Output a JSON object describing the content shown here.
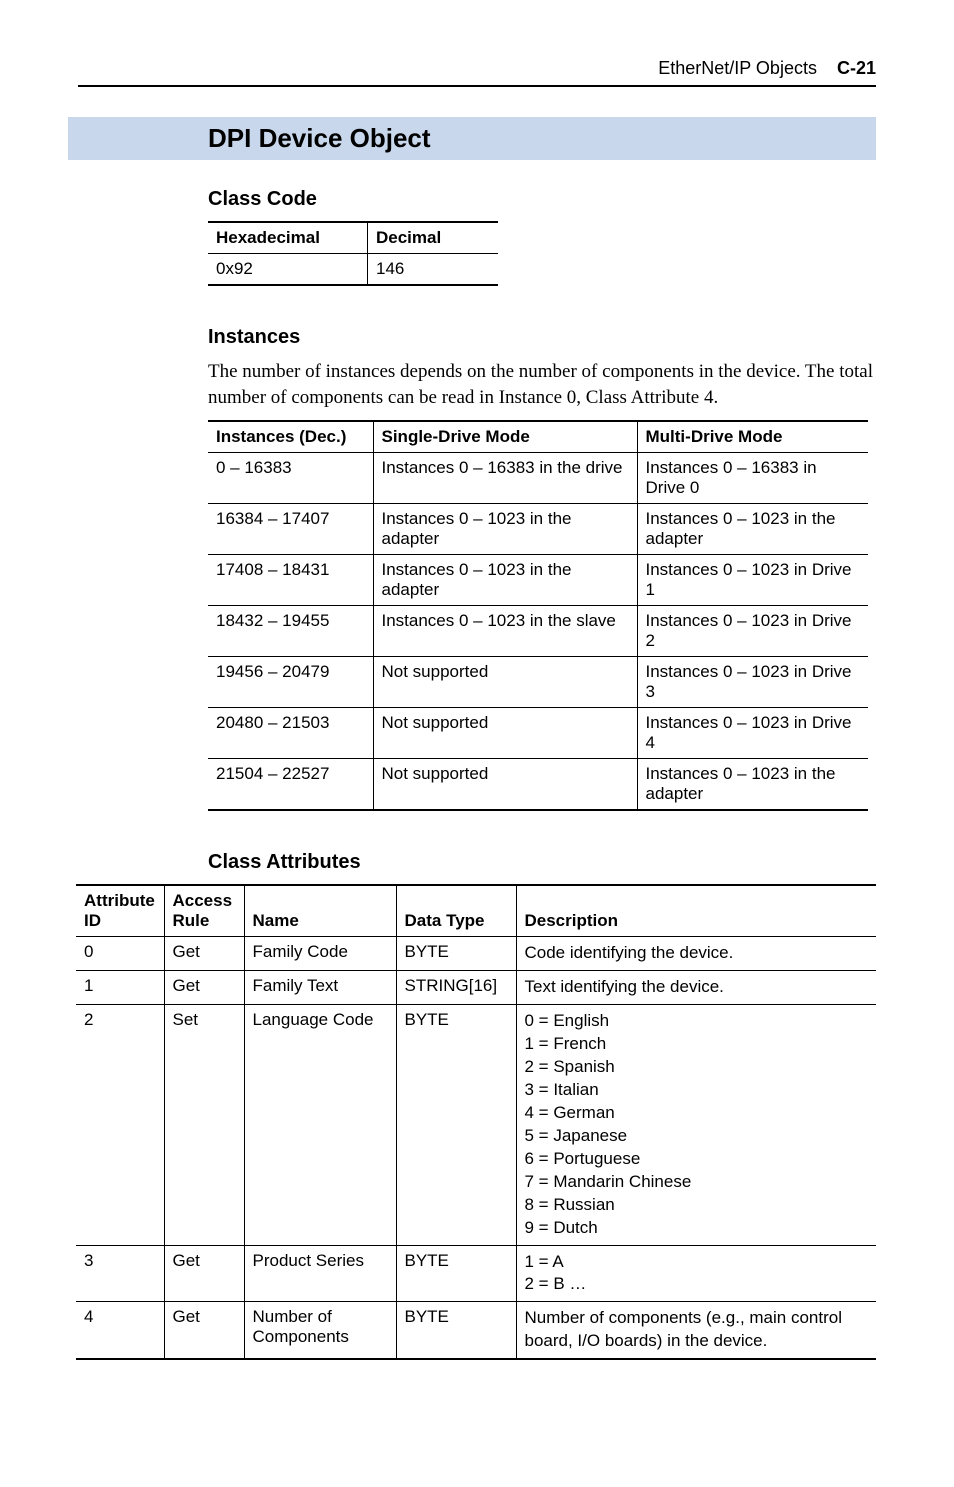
{
  "header": {
    "title": "EtherNet/IP Objects",
    "page_code": "C-21"
  },
  "section_title": "DPI Device Object",
  "class_code": {
    "heading": "Class Code",
    "headers": [
      "Hexadecimal",
      "Decimal"
    ],
    "row": [
      "0x92",
      "146"
    ]
  },
  "instances": {
    "heading": "Instances",
    "paragraph": "The number of instances depends on the number of components in the device. The total number of components can be read in Instance 0, Class Attribute 4.",
    "headers": [
      "Instances (Dec.)",
      "Single-Drive Mode",
      "Multi-Drive Mode"
    ],
    "rows": [
      [
        "0 – 16383",
        "Instances 0 – 16383 in the drive",
        "Instances 0 – 16383 in Drive 0"
      ],
      [
        "16384 – 17407",
        "Instances 0 – 1023 in the adapter",
        "Instances 0 – 1023 in the adapter"
      ],
      [
        "17408 – 18431",
        "Instances 0 – 1023 in the adapter",
        "Instances 0 – 1023 in Drive 1"
      ],
      [
        "18432 – 19455",
        "Instances 0 – 1023 in the slave",
        "Instances 0 – 1023 in Drive 2"
      ],
      [
        "19456 – 20479",
        "Not supported",
        "Instances 0 – 1023 in Drive 3"
      ],
      [
        "20480 – 21503",
        "Not supported",
        "Instances 0 – 1023 in Drive 4"
      ],
      [
        "21504 – 22527",
        "Not supported",
        "Instances 0 – 1023 in the adapter"
      ]
    ]
  },
  "class_attrs": {
    "heading": "Class Attributes",
    "headers": [
      "Attribute\nID",
      "Access\nRule",
      "Name",
      "Data Type",
      "Description"
    ],
    "rows": [
      {
        "id": "0",
        "rule": "Get",
        "name": "Family Code",
        "type": "BYTE",
        "desc": "Code identifying the device."
      },
      {
        "id": "1",
        "rule": "Get",
        "name": "Family Text",
        "type": "STRING[16]",
        "desc": "Text identifying the device."
      },
      {
        "id": "2",
        "rule": "Set",
        "name": "Language Code",
        "type": "BYTE",
        "desc": "0 = English\n1 = French\n2 = Spanish\n3 = Italian\n4 = German\n5 = Japanese\n6 = Portuguese\n7 = Mandarin Chinese\n8 = Russian\n9 = Dutch"
      },
      {
        "id": "3",
        "rule": "Get",
        "name": "Product Series",
        "type": "BYTE",
        "desc": "1 = A\n2 = B …"
      },
      {
        "id": "4",
        "rule": "Get",
        "name": "Number of Components",
        "type": "BYTE",
        "desc": "Number of components (e.g., main control board, I/O boards) in the device."
      }
    ]
  }
}
